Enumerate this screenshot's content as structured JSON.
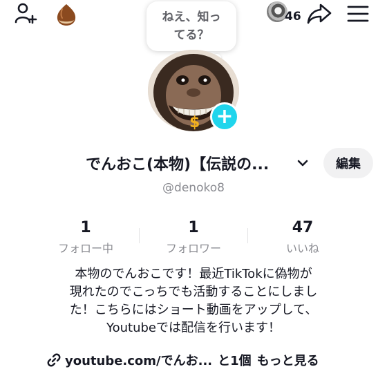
{
  "top_bar": {
    "viewer_count": "46"
  },
  "bubble": {
    "text": "ねえ、知っ\nてる？"
  },
  "profile": {
    "display_name": "でんおこ(本物)【伝説の...",
    "edit_label": "編集",
    "username": "@denoko8"
  },
  "stats": [
    {
      "value": "1",
      "label": "フォロー中"
    },
    {
      "value": "1",
      "label": "フォロワー"
    },
    {
      "value": "47",
      "label": "いいね"
    }
  ],
  "bio": "本物のでんおこです！最近TikTokに偽物が\n現れたのでこっちでも活動することにしまし\nた！こちらにはショート動画をアップして、\nYoutubeでは配信を行います！",
  "link": {
    "text": "youtube.com/でんお...",
    "extra": "と1個",
    "more": "もっと見る"
  },
  "colors": {
    "accent": "#20d5ec",
    "text": "#161823",
    "muted": "#8a8b91",
    "button_bg": "#f1f1f2"
  },
  "icons": [
    "add-friend-icon",
    "chestnut-icon",
    "share-icon",
    "menu-icon",
    "chevron-down-icon",
    "link-icon",
    "plus-icon"
  ]
}
